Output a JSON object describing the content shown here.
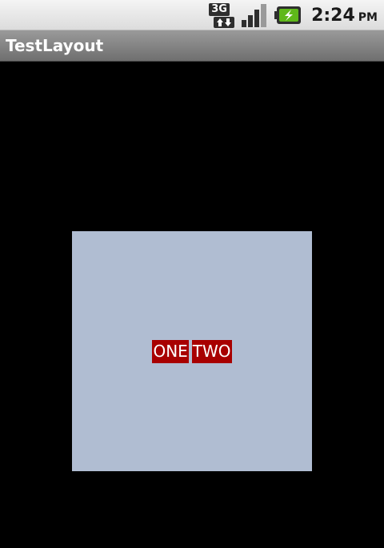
{
  "status_bar": {
    "network_label": "3G",
    "time": "2:24",
    "ampm": "PM",
    "icons": [
      "3g-data-icon",
      "signal-icon",
      "battery-charging-icon"
    ],
    "colors": {
      "battery_green": "#5fb81a",
      "background": "#e8e8e8"
    }
  },
  "title_bar": {
    "title": "TestLayout"
  },
  "content": {
    "background": "#000000",
    "square_color": "#b0bdd2",
    "labels": [
      {
        "text": "ONE",
        "background": "#a80000"
      },
      {
        "text": "TWO",
        "background": "#a80000"
      }
    ]
  }
}
